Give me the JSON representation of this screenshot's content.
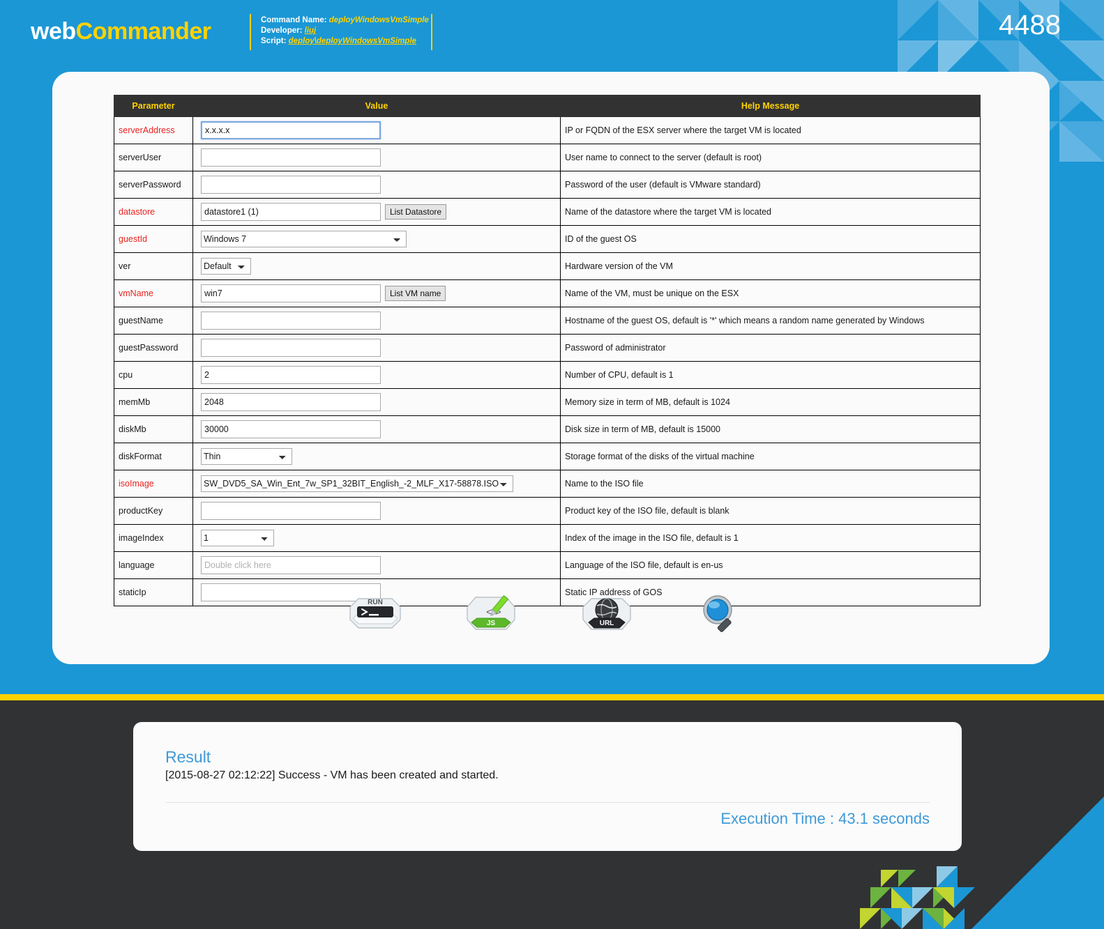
{
  "header": {
    "brand_web": "web",
    "brand_commander": "Commander",
    "command_name_label": "Command Name:",
    "command_name_value": "deployWindowsVmSimple",
    "developer_label": "Developer:",
    "developer_value": "liuj",
    "script_label": "Script:",
    "script_value": "deploy\\deployWindowsVmSimple",
    "session_id": "4488",
    "accent_blue": "#1b97d5",
    "accent_yellow": "#ffd200"
  },
  "table": {
    "columns": [
      "Parameter",
      "Value",
      "Help Message"
    ],
    "rows": [
      {
        "param": "serverAddress",
        "required": true,
        "control": "text",
        "value": "x.x.x.x",
        "placeholder": "",
        "focused": true,
        "help": "IP or FQDN of the ESX server where the target VM is located"
      },
      {
        "param": "serverUser",
        "required": false,
        "control": "text",
        "value": "",
        "placeholder": "",
        "focused": false,
        "help": "User name to connect to the server (default is root)"
      },
      {
        "param": "serverPassword",
        "required": false,
        "control": "text",
        "value": "",
        "placeholder": "",
        "focused": false,
        "help": "Password of the user (default is VMware standard)"
      },
      {
        "param": "datastore",
        "required": true,
        "control": "text-button",
        "value": "datastore1 (1)",
        "placeholder": "",
        "focused": false,
        "button": "List Datastore",
        "help": "Name of the datastore where the target VM is located"
      },
      {
        "param": "guestId",
        "required": true,
        "control": "select",
        "value": "Windows 7",
        "select_width": "w-guestid",
        "options": [
          "Windows 7"
        ],
        "help": "ID of the guest OS"
      },
      {
        "param": "ver",
        "required": false,
        "control": "select",
        "value": "Default",
        "select_width": "w-ver",
        "options": [
          "Default"
        ],
        "help": "Hardware version of the VM"
      },
      {
        "param": "vmName",
        "required": true,
        "control": "text-button",
        "value": "win7",
        "placeholder": "",
        "focused": false,
        "button": "List VM name",
        "help": "Name of the VM, must be unique on the ESX"
      },
      {
        "param": "guestName",
        "required": false,
        "control": "text",
        "value": "",
        "placeholder": "",
        "focused": false,
        "help": "Hostname of the guest OS, default is '*' which means a random name generated by Windows"
      },
      {
        "param": "guestPassword",
        "required": false,
        "control": "text",
        "value": "",
        "placeholder": "",
        "focused": false,
        "help": "Password of administrator"
      },
      {
        "param": "cpu",
        "required": false,
        "control": "text",
        "value": "2",
        "placeholder": "",
        "focused": false,
        "help": "Number of CPU, default is 1"
      },
      {
        "param": "memMb",
        "required": false,
        "control": "text",
        "value": "2048",
        "placeholder": "",
        "focused": false,
        "help": "Memory size in term of MB, default is 1024"
      },
      {
        "param": "diskMb",
        "required": false,
        "control": "text",
        "value": "30000",
        "placeholder": "",
        "focused": false,
        "help": "Disk size in term of MB, default is 15000"
      },
      {
        "param": "diskFormat",
        "required": false,
        "control": "select",
        "value": "Thin",
        "select_width": "w-diskfmt",
        "options": [
          "Thin"
        ],
        "help": "Storage format of the disks of the virtual machine"
      },
      {
        "param": "isoImage",
        "required": true,
        "control": "select",
        "value": "SW_DVD5_SA_Win_Ent_7w_SP1_32BIT_English_-2_MLF_X17-58878.ISO",
        "select_width": "w-iso",
        "options": [
          "SW_DVD5_SA_Win_Ent_7w_SP1_32BIT_English_-2_MLF_X17-58878.ISO"
        ],
        "help": "Name to the ISO file"
      },
      {
        "param": "productKey",
        "required": false,
        "control": "text",
        "value": "",
        "placeholder": "",
        "focused": false,
        "help": "Product key of the ISO file, default is blank"
      },
      {
        "param": "imageIndex",
        "required": false,
        "control": "select",
        "value": "1",
        "select_width": "w-imgidx",
        "options": [
          "1"
        ],
        "help": "Index of the image in the ISO file, default is 1"
      },
      {
        "param": "language",
        "required": false,
        "control": "text",
        "value": "",
        "placeholder": "Double click here",
        "focused": false,
        "help": "Language of the ISO file, default is en-us"
      },
      {
        "param": "staticIp",
        "required": false,
        "control": "text",
        "value": "",
        "placeholder": "",
        "focused": false,
        "help": "Static IP address of GOS"
      }
    ]
  },
  "actions": [
    {
      "name": "run-icon",
      "label": "RUN"
    },
    {
      "name": "js-icon",
      "label": "JS"
    },
    {
      "name": "url-icon",
      "label": "URL"
    },
    {
      "name": "search-icon",
      "label": ""
    }
  ],
  "result": {
    "title": "Result",
    "message": "[2015-08-27 02:12:22] Success - VM has been created and started.",
    "execution_time": "Execution Time : 43.1 seconds"
  }
}
